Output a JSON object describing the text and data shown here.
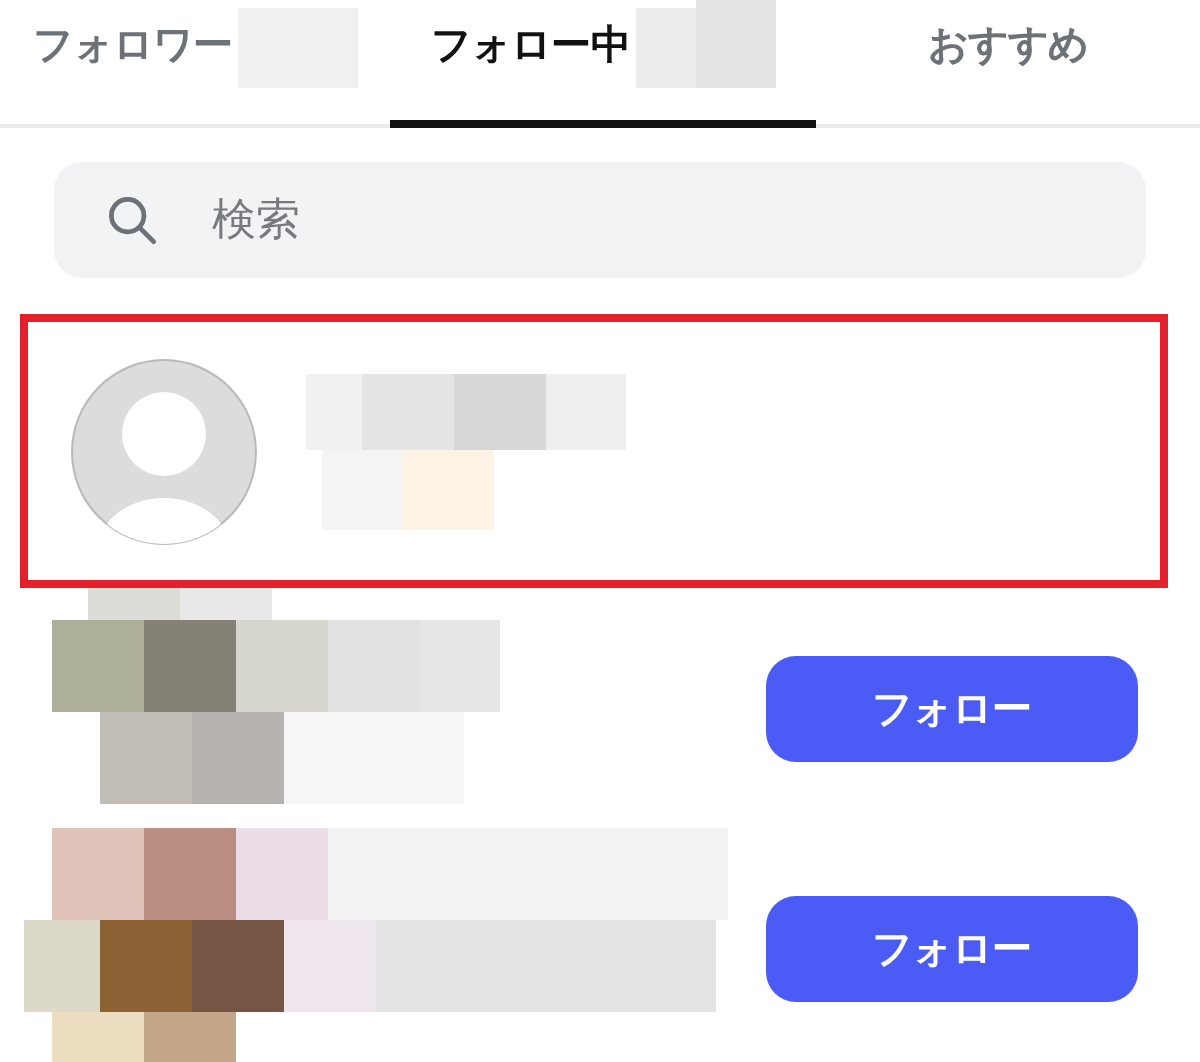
{
  "tabs": [
    {
      "label": "フォロワー",
      "selected": false,
      "mosaic": true
    },
    {
      "label": "フォロー中",
      "selected": true,
      "mosaic": true
    },
    {
      "label": "おすすめ",
      "selected": false,
      "mosaic": false
    }
  ],
  "search": {
    "placeholder": "検索"
  },
  "users": [
    {
      "highlighted": true,
      "kind": "default"
    },
    {
      "highlighted": false,
      "kind": "mosaic",
      "button": "フォロー"
    },
    {
      "highlighted": false,
      "kind": "mosaic",
      "button": "フォロー"
    }
  ]
}
